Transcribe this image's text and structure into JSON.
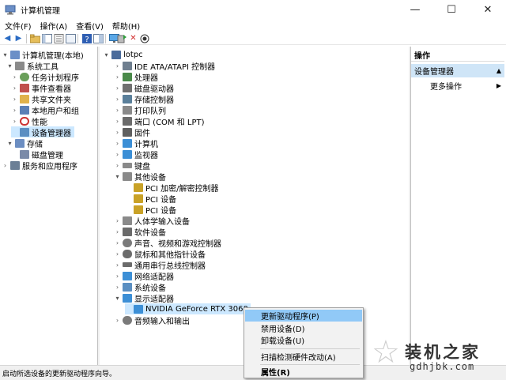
{
  "window": {
    "title": "计算机管理"
  },
  "window_controls": {
    "minimize": "—",
    "maximize": "☐",
    "close": "✕"
  },
  "menu": [
    "文件(F)",
    "操作(A)",
    "查看(V)",
    "帮助(H)"
  ],
  "toolbar_icons": [
    "back-icon",
    "forward-icon",
    "folder-up-icon",
    "console-tree-icon",
    "properties-icon",
    "list-icon",
    "help-icon",
    "show-hide-icon",
    "monitor-icon",
    "update-driver-icon",
    "uninstall-icon",
    "enable-device-icon"
  ],
  "left_tree": [
    {
      "label": "计算机管理(本地)",
      "arrow": "▾",
      "icon": "computer-management-icon",
      "color": "#6b8fc7"
    },
    {
      "label": "系统工具",
      "arrow": "▾",
      "icon": "system-tools-icon",
      "color": "#8a8a8a"
    },
    {
      "label": "任务计划程序",
      "arrow": "›",
      "icon": "task-scheduler-icon",
      "color": "#6a9f5a"
    },
    {
      "label": "事件查看器",
      "arrow": "›",
      "icon": "event-viewer-icon",
      "color": "#c0504d"
    },
    {
      "label": "共享文件夹",
      "arrow": "›",
      "icon": "shared-folders-icon",
      "color": "#e0b24c"
    },
    {
      "label": "本地用户和组",
      "arrow": "›",
      "icon": "local-users-icon",
      "color": "#5a7fb6"
    },
    {
      "label": "性能",
      "arrow": "›",
      "icon": "performance-icon",
      "color": "#cc3333"
    },
    {
      "label": "设备管理器",
      "arrow": "",
      "icon": "device-manager-icon",
      "color": "#5b8fc2"
    },
    {
      "label": "存储",
      "arrow": "▾",
      "icon": "storage-icon",
      "color": "#6c8ec2"
    },
    {
      "label": "磁盘管理",
      "arrow": "",
      "icon": "disk-management-icon",
      "color": "#7a8aa8"
    },
    {
      "label": "服务和应用程序",
      "arrow": "›",
      "icon": "services-apps-icon",
      "color": "#6b7f96"
    }
  ],
  "device_tree": [
    {
      "label": "lotpc",
      "arrow": "▾",
      "icon": "computer-icon",
      "color": "#4a6b9b"
    },
    {
      "label": "IDE ATA/ATAPI 控制器",
      "arrow": "›",
      "icon": "ide-controller-icon",
      "color": "#6f7f8f"
    },
    {
      "label": "处理器",
      "arrow": "›",
      "icon": "processor-icon",
      "color": "#4a8a4a"
    },
    {
      "label": "磁盘驱动器",
      "arrow": "›",
      "icon": "disk-drive-icon",
      "color": "#707070"
    },
    {
      "label": "存储控制器",
      "arrow": "›",
      "icon": "storage-controller-icon",
      "color": "#5a7f9a"
    },
    {
      "label": "打印队列",
      "arrow": "›",
      "icon": "printer-icon",
      "color": "#8a8a8a"
    },
    {
      "label": "端口 (COM 和 LPT)",
      "arrow": "›",
      "icon": "port-icon",
      "color": "#6b6b6b"
    },
    {
      "label": "固件",
      "arrow": "›",
      "icon": "firmware-icon",
      "color": "#5f5f5f"
    },
    {
      "label": "计算机",
      "arrow": "›",
      "icon": "computer-icon",
      "color": "#3c8fd6"
    },
    {
      "label": "监视器",
      "arrow": "›",
      "icon": "monitor-icon",
      "color": "#3c8fd6"
    },
    {
      "label": "键盘",
      "arrow": "›",
      "icon": "keyboard-icon",
      "color": "#8a8a8a"
    },
    {
      "label": "其他设备",
      "arrow": "▾",
      "icon": "other-devices-icon",
      "color": "#8a8a8a"
    },
    {
      "label": "PCI 加密/解密控制器",
      "arrow": "",
      "icon": "unknown-device-icon",
      "color": "#c9a227"
    },
    {
      "label": "PCI 设备",
      "arrow": "",
      "icon": "unknown-device-icon",
      "color": "#c9a227"
    },
    {
      "label": "PCI 设备",
      "arrow": "",
      "icon": "unknown-device-icon",
      "color": "#c9a227"
    },
    {
      "label": "人体学输入设备",
      "arrow": "›",
      "icon": "hid-icon",
      "color": "#8a8a8a"
    },
    {
      "label": "软件设备",
      "arrow": "›",
      "icon": "software-device-icon",
      "color": "#6b6b6b"
    },
    {
      "label": "声音、视频和游戏控制器",
      "arrow": "›",
      "icon": "sound-icon",
      "color": "#7a7a7a"
    },
    {
      "label": "鼠标和其他指针设备",
      "arrow": "›",
      "icon": "mouse-icon",
      "color": "#6b6b6b"
    },
    {
      "label": "通用串行总线控制器",
      "arrow": "›",
      "icon": "usb-icon",
      "color": "#6b6b6b"
    },
    {
      "label": "网络适配器",
      "arrow": "›",
      "icon": "network-adapter-icon",
      "color": "#3c8fd6"
    },
    {
      "label": "系统设备",
      "arrow": "›",
      "icon": "system-device-icon",
      "color": "#5b8fc2"
    },
    {
      "label": "显示适配器",
      "arrow": "▾",
      "icon": "display-adapter-icon",
      "color": "#3c8fd6"
    },
    {
      "label": "NVIDIA GeForce RTX 3060",
      "arrow": "",
      "icon": "display-adapter-icon",
      "color": "#3c8fd6"
    },
    {
      "label": "音频输入和输出",
      "arrow": "›",
      "icon": "audio-io-icon",
      "color": "#7a7a7a"
    }
  ],
  "actions": {
    "header": "操作",
    "group": "设备管理器",
    "more": "更多操作"
  },
  "context_menu": [
    "更新驱动程序(P)",
    "禁用设备(D)",
    "卸载设备(U)",
    "扫描检测硬件改动(A)",
    "属性(R)"
  ],
  "status": "启动所选设备的更新驱动程序向导。",
  "watermark": {
    "title": "装机之家",
    "sub": "gdhjbk.com"
  },
  "colors": {
    "selection": "#cce8ff",
    "context_hover": "#91c9f7",
    "action_group": "#cfe5f7"
  }
}
